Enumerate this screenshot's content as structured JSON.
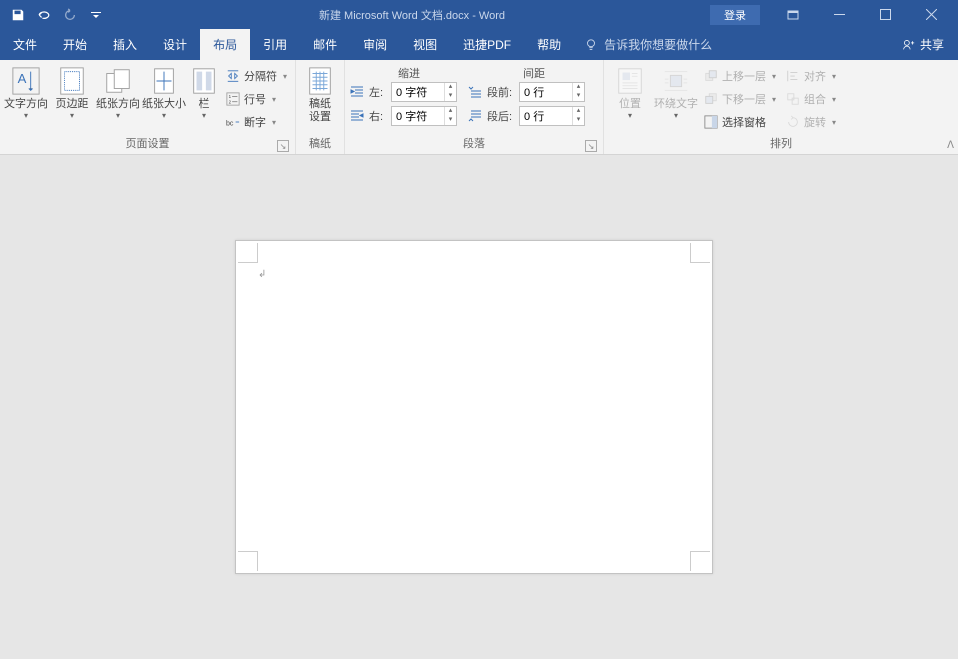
{
  "title": "新建 Microsoft Word 文档.docx  -  Word",
  "login": "登录",
  "tabs": [
    "文件",
    "开始",
    "插入",
    "设计",
    "布局",
    "引用",
    "邮件",
    "审阅",
    "视图",
    "迅捷PDF",
    "帮助"
  ],
  "active_tab_index": 4,
  "tellme": "告诉我你想要做什么",
  "share": "共享",
  "ribbon": {
    "page_setup": {
      "label": "页面设置",
      "text_direction": "文字方向",
      "margins": "页边距",
      "orientation": "纸张方向",
      "size": "纸张大小",
      "columns": "栏",
      "breaks": "分隔符",
      "line_numbers": "行号",
      "hyphenation": "断字"
    },
    "manuscript": {
      "label": "稿纸",
      "settings": "稿纸\n设置"
    },
    "paragraph": {
      "label": "段落",
      "indent": "缩进",
      "spacing": "间距",
      "left": "左:",
      "right": "右:",
      "before": "段前:",
      "after": "段后:",
      "left_val": "0 字符",
      "right_val": "0 字符",
      "before_val": "0 行",
      "after_val": "0 行"
    },
    "arrange": {
      "label": "排列",
      "position": "位置",
      "wrap": "环绕文字",
      "bring_forward": "上移一层",
      "send_backward": "下移一层",
      "selection_pane": "选择窗格",
      "align": "对齐",
      "group": "组合",
      "rotate": "旋转"
    }
  }
}
